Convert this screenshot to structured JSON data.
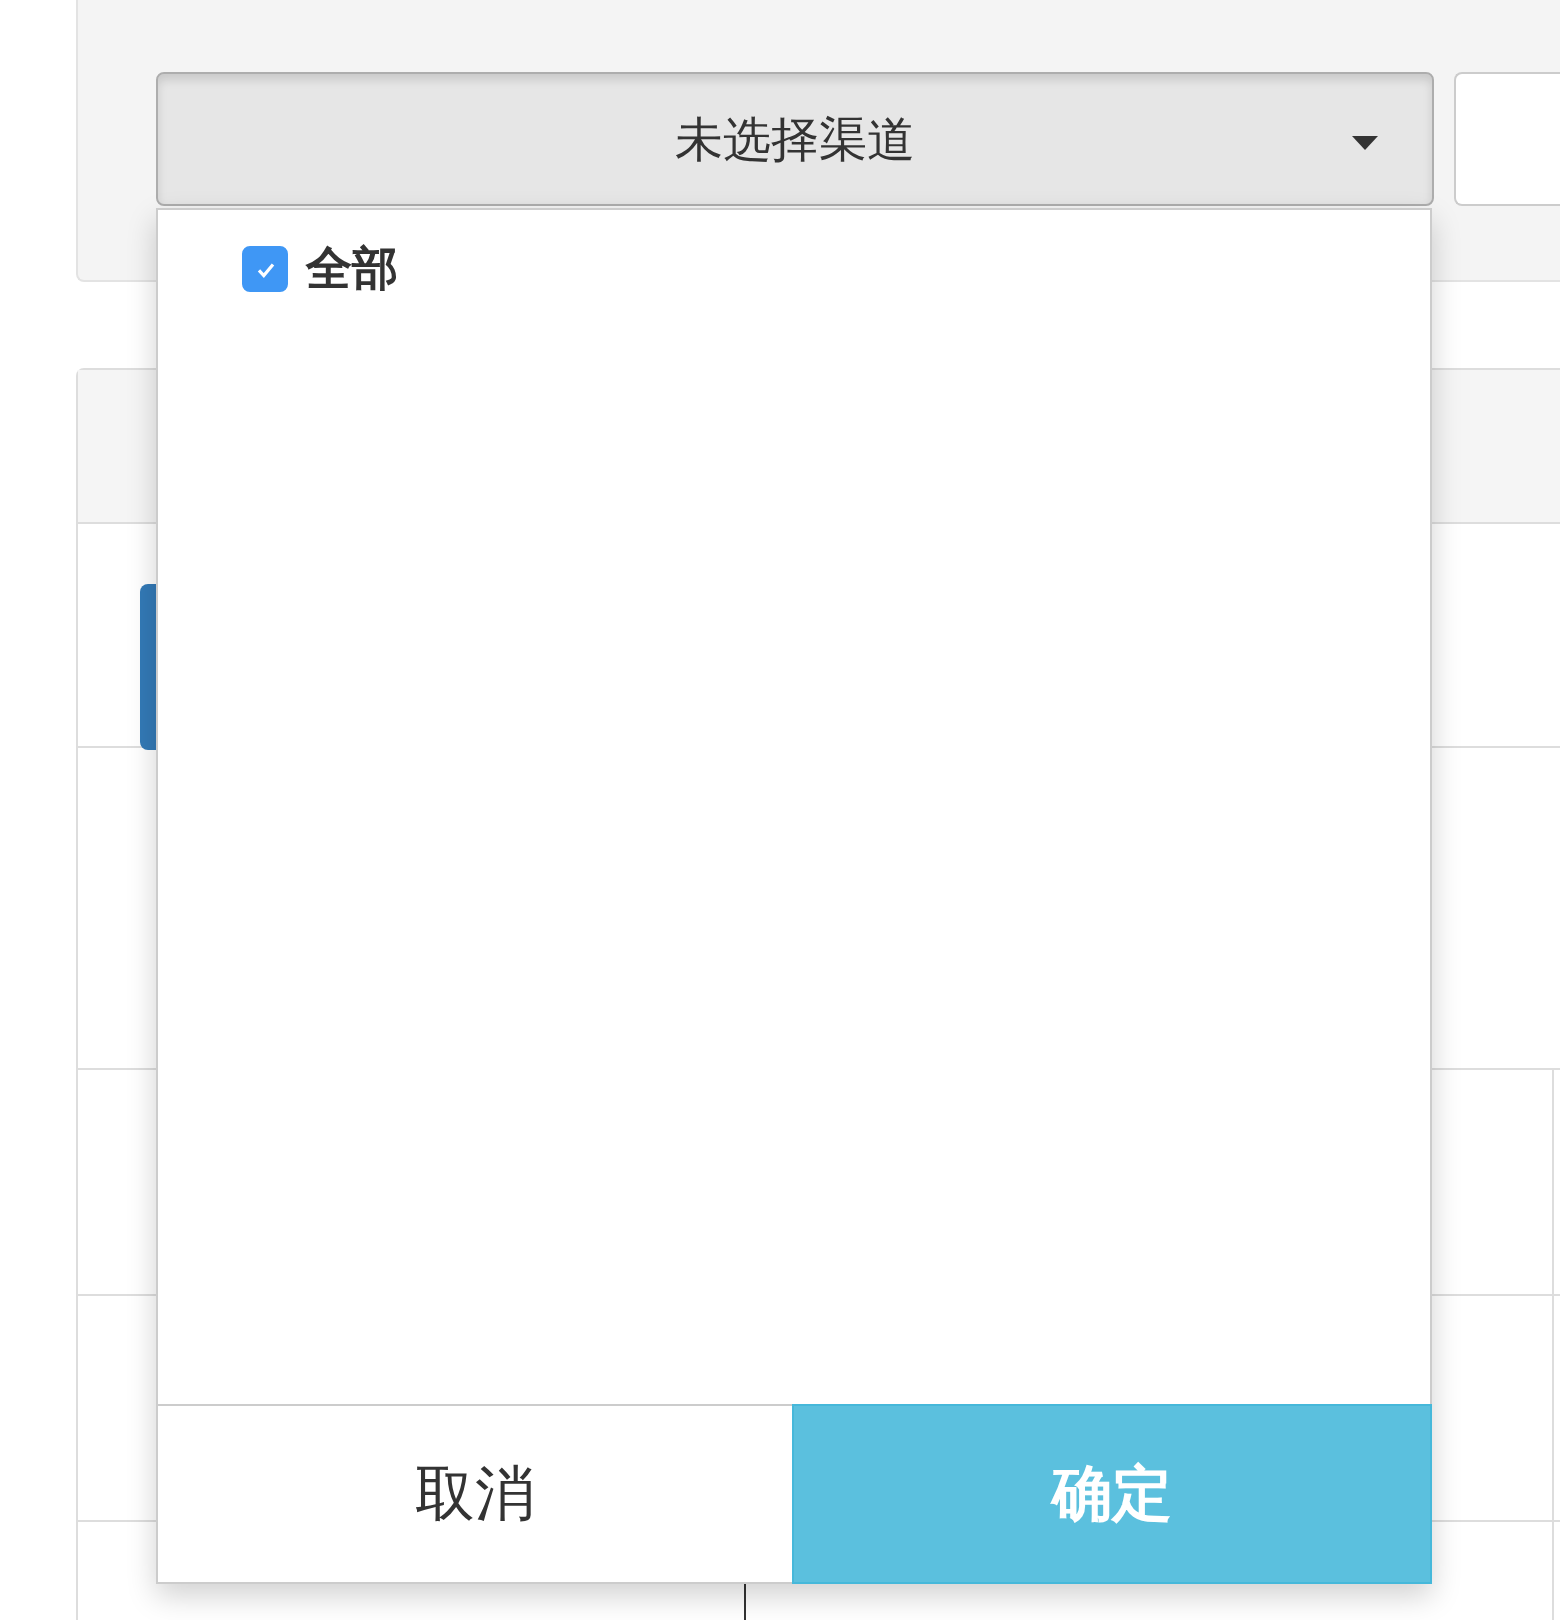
{
  "channel_select": {
    "label": "未选择渠道",
    "expanded": true
  },
  "options": [
    {
      "label": "全部",
      "checked": true
    }
  ],
  "buttons": [
    {
      "label": "取消",
      "kind": "cancel"
    },
    {
      "label": "确定",
      "kind": "confirm"
    }
  ]
}
